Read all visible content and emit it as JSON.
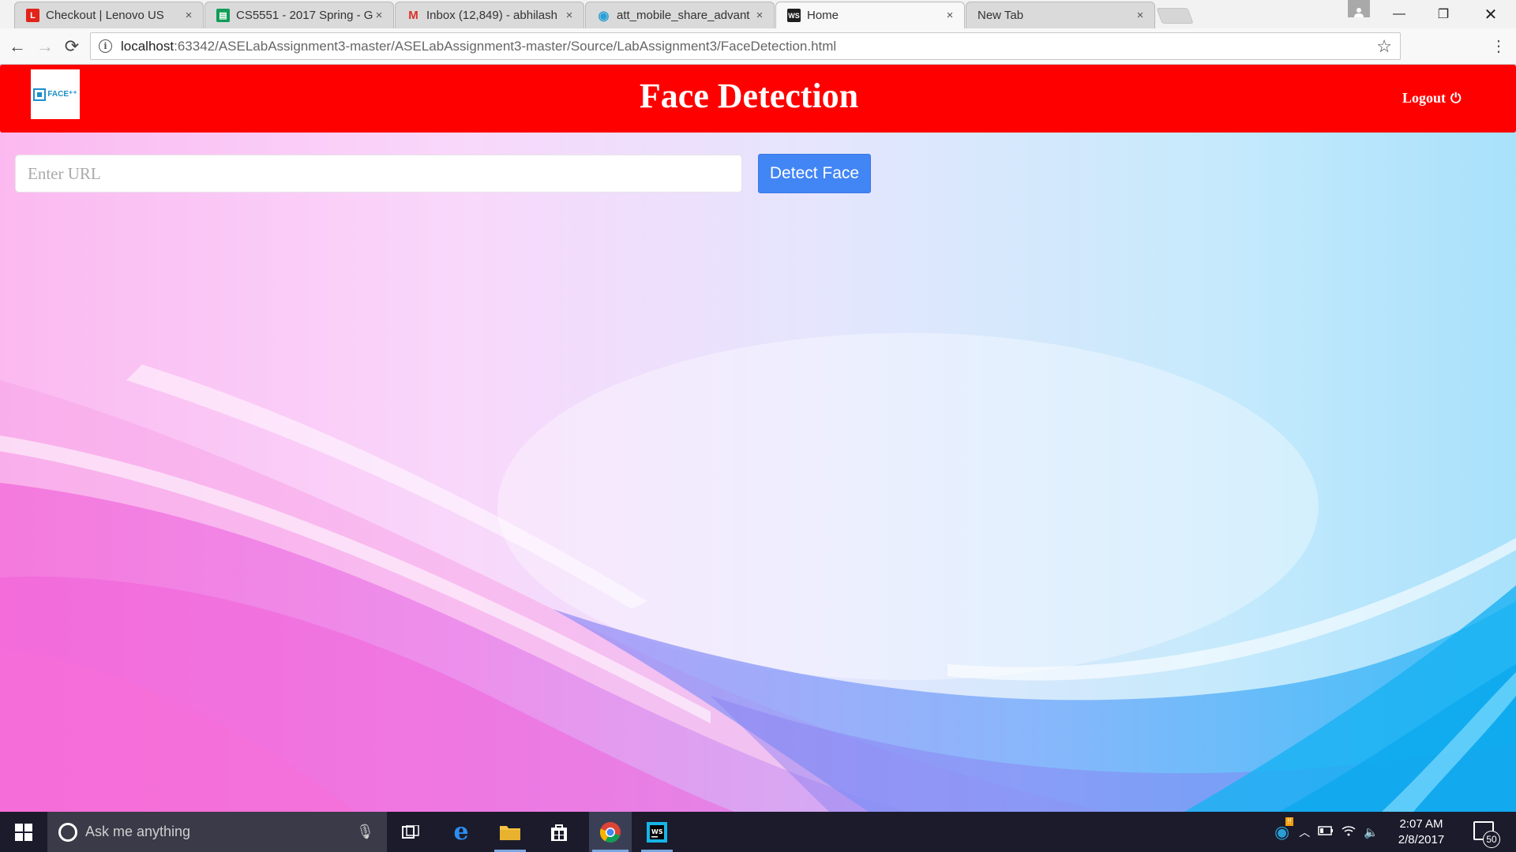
{
  "browser": {
    "tabs": [
      {
        "title": "Checkout | Lenovo US",
        "favicon": "L",
        "favicon_color": "#e2231a"
      },
      {
        "title": "CS5551 - 2017 Spring - G",
        "favicon": "▤",
        "favicon_color": "#0f9d58"
      },
      {
        "title": "Inbox (12,849) - abhilash",
        "favicon": "M",
        "favicon_color": "#d93025"
      },
      {
        "title": "att_mobile_share_advant",
        "favicon": "◉",
        "favicon_color": "#2a9fd6"
      },
      {
        "title": "Home",
        "favicon": "WS",
        "favicon_color": "#1e1e1e"
      },
      {
        "title": "New Tab",
        "favicon": "",
        "favicon_color": ""
      }
    ],
    "address": {
      "host": "localhost",
      "rest": ":63342/ASELabAssignment3-master/ASELabAssignment3-master/Source/LabAssignment3/FaceDetection.html"
    },
    "icons": {
      "back": "←",
      "forward": "→",
      "reload": "⟳",
      "info": "i",
      "star": "☆",
      "menu": "⋮",
      "minimize": "—",
      "maximize": "❐",
      "close": "✕",
      "tab_close": "×"
    }
  },
  "app": {
    "logo_text": "FACE⁺⁺",
    "title": "Face Detection",
    "logout_label": "Logout",
    "power_icon": "⏻",
    "url_placeholder": "Enter URL",
    "detect_button": "Detect Face",
    "colors": {
      "header": "#ff0000",
      "button": "#4285f4"
    }
  },
  "taskbar": {
    "search_placeholder": "Ask me anything",
    "time": "2:07 AM",
    "date": "2/8/2017",
    "notification_count": "50",
    "icons": [
      "task-view-icon",
      "edge-icon",
      "file-explorer-icon",
      "store-icon",
      "chrome-icon",
      "webstorm-icon"
    ]
  }
}
